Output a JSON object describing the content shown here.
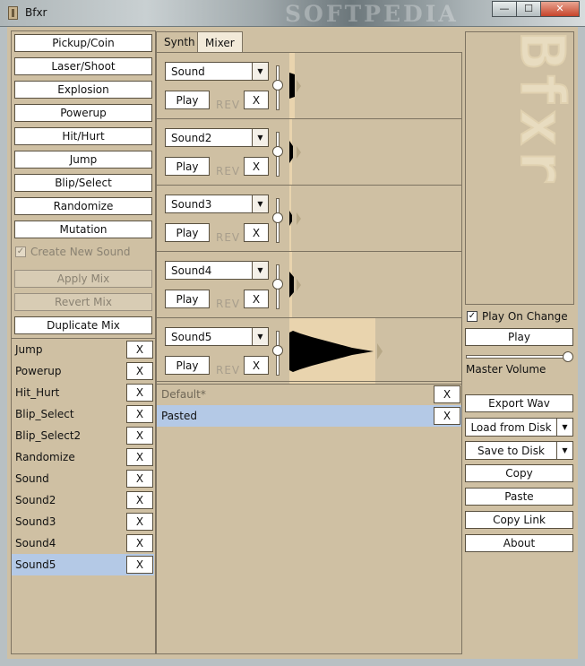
{
  "window": {
    "title": "Bfxr",
    "watermark": "SOFTPEDIA",
    "minimize_glyph": "—",
    "maximize_glyph": "☐",
    "close_glyph": "✕"
  },
  "generator_buttons": [
    "Pickup/Coin",
    "Laser/Shoot",
    "Explosion",
    "Powerup",
    "Hit/Hurt",
    "Jump",
    "Blip/Select",
    "Randomize",
    "Mutation"
  ],
  "create_new_sound": {
    "label": "Create New Sound",
    "checked": true,
    "check_glyph": "✓"
  },
  "mix_actions": {
    "apply": "Apply Mix",
    "revert": "Revert Mix",
    "duplicate": "Duplicate Mix"
  },
  "sound_list": {
    "items": [
      "Jump",
      "Powerup",
      "Hit_Hurt",
      "Blip_Select",
      "Blip_Select2",
      "Randomize",
      "Sound",
      "Sound2",
      "Sound3",
      "Sound4",
      "Sound5"
    ],
    "selected_index": 10,
    "delete_label": "X"
  },
  "tabs": {
    "synth": "Synth",
    "mixer": "Mixer",
    "active": "Mixer"
  },
  "tracks": [
    {
      "sound": "Sound",
      "play": "Play",
      "rev": "REV",
      "delete": "X",
      "arrow": "▼"
    },
    {
      "sound": "Sound2",
      "play": "Play",
      "rev": "REV",
      "delete": "X",
      "arrow": "▼"
    },
    {
      "sound": "Sound3",
      "play": "Play",
      "rev": "REV",
      "delete": "X",
      "arrow": "▼"
    },
    {
      "sound": "Sound4",
      "play": "Play",
      "rev": "REV",
      "delete": "X",
      "arrow": "▼"
    },
    {
      "sound": "Sound5",
      "play": "Play",
      "rev": "REV",
      "delete": "X",
      "arrow": "▼"
    }
  ],
  "mix_list": {
    "items": [
      "Default*",
      "Pasted"
    ],
    "selected_index": 1,
    "delete_label": "X"
  },
  "right_panel": {
    "logo_text": "Bfxr",
    "play_on_change": {
      "label": "Play On Change",
      "checked": true,
      "check_glyph": "✓"
    },
    "play": "Play",
    "master_volume_label": "Master Volume",
    "master_volume": 1.0,
    "export_wav": "Export Wav",
    "load_from_disk": "Load from Disk",
    "save_to_disk": "Save to Disk",
    "dropdown_arrow": "▼",
    "copy": "Copy",
    "paste": "Paste",
    "copy_link": "Copy Link",
    "about": "About"
  }
}
